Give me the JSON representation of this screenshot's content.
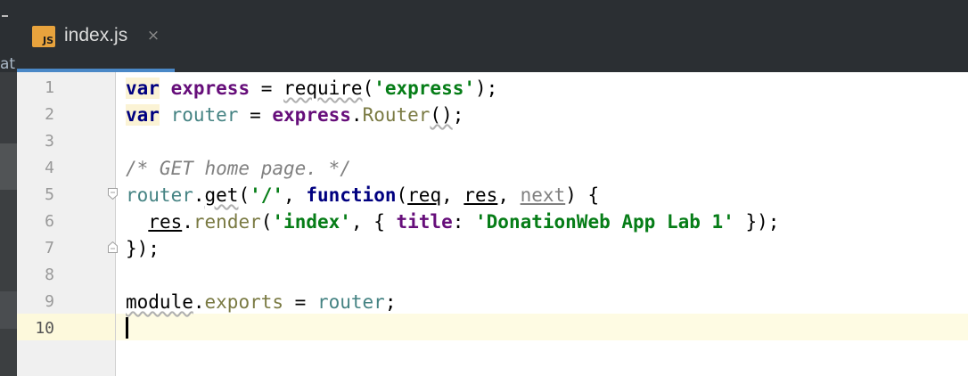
{
  "tab": {
    "icon_label": "JS",
    "filename": "index.js",
    "close_glyph": "×"
  },
  "left_panel": {
    "peek_text": "at"
  },
  "gutter": {
    "line_numbers": [
      "1",
      "2",
      "3",
      "4",
      "5",
      "6",
      "7",
      "8",
      "9",
      "10"
    ],
    "current_line": "10"
  },
  "code": {
    "line1": {
      "kw": "var",
      "name": "express",
      "op": " = ",
      "call": "require",
      "open": "(",
      "arg": "'express'",
      "close": ");"
    },
    "line2": {
      "kw": "var",
      "name": "router",
      "op": " = ",
      "obj": "express",
      "dot": ".",
      "method": "Router",
      "parens": "()",
      "end": ";"
    },
    "line4": {
      "comment": "/* GET home page. */"
    },
    "line5": {
      "obj": "router",
      "dot": ".",
      "method": "get",
      "open": "(",
      "arg": "'/'",
      "comma1": ", ",
      "kw": "function",
      "paren": "(",
      "p1": "req",
      "c1": ", ",
      "p2": "res",
      "c2": ", ",
      "p3": "next",
      "end": ") {"
    },
    "line6": {
      "indent": "  ",
      "obj": "res",
      "dot": ".",
      "method": "render",
      "open": "(",
      "arg": "'index'",
      "c1": ", { ",
      "key": "title",
      "colon": ": ",
      "val": "'DonationWeb App Lab 1'",
      "end": " });"
    },
    "line7": {
      "text": "});"
    },
    "line9": {
      "obj": "module",
      "dot": ".",
      "prop": "exports",
      "op": " = ",
      "val": "router",
      "end": ";"
    }
  },
  "colors": {
    "tabbar_bg": "#2b2f33",
    "tab_accent": "#4a88c7",
    "js_icon": "#e8a33d",
    "keyword": "#000080",
    "string": "#067d17",
    "global_var": "#660e7a",
    "local_var": "#458383",
    "comment": "#808080",
    "current_line_bg": "#fefbe3"
  }
}
